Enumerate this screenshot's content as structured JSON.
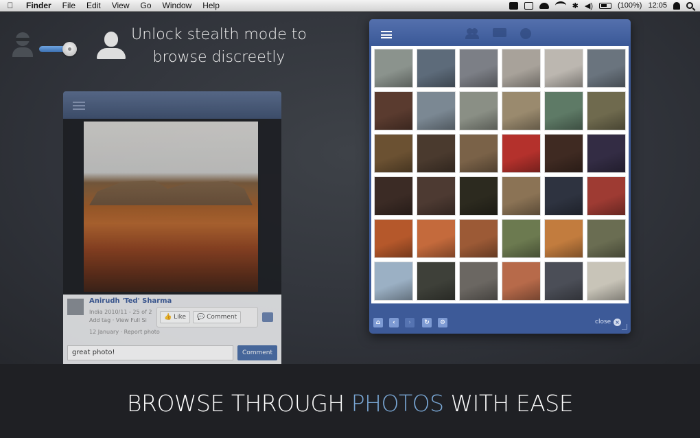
{
  "menubar": {
    "app_name": "Finder",
    "items": [
      "File",
      "Edit",
      "View",
      "Go",
      "Window",
      "Help"
    ],
    "battery": "(100%)",
    "clock": "12:05"
  },
  "stealth": {
    "text_line1": "Unlock stealth mode to",
    "text_line2": "browse discreetly",
    "toggle_on": true
  },
  "ghost_post": {
    "name": "Anirudh 'Ted' Sharma",
    "meta_line1": "India 2010/11 - 25 of 2",
    "meta_line2": "Add tag · View Full Si",
    "date": "12 January · Report photo",
    "like_label": "Like",
    "comment_label": "Comment",
    "comment_value": "great photo!",
    "comment_button": "Comment"
  },
  "photo_window": {
    "toolbar_icons": [
      "friends-icon",
      "messages-icon",
      "globe-icon"
    ],
    "thumbnails": [
      "#8b938d",
      "#5d6b7a",
      "#7c7f86",
      "#a8a29a",
      "#bcb7b0",
      "#6a747e",
      "#5a3b2f",
      "#7b8893",
      "#8a8f85",
      "#9a8a6e",
      "#5e7a66",
      "#6f6a4e",
      "#6b5132",
      "#4a3a2e",
      "#7a6248",
      "#b4312c",
      "#3f2a22",
      "#332c44",
      "#3b2b25",
      "#4d3a32",
      "#2c2a1f",
      "#8b7355",
      "#2e3340",
      "#9e3b33",
      "#b5582b",
      "#c46a3c",
      "#9c5a36",
      "#6c7a50",
      "#c27c3e",
      "#6a6d52",
      "#9bb0c4",
      "#3e4039",
      "#6b6762",
      "#b76a4a",
      "#4b4e57",
      "#c8c4b8"
    ],
    "close_label": "close"
  },
  "tagline": {
    "part1": "BROWSE THROUGH ",
    "highlight": "PHOTOS",
    "part2": " WITH EASE"
  },
  "colors": {
    "accent_blue": "#3b5998",
    "highlight_text": "#7aa8d6"
  }
}
